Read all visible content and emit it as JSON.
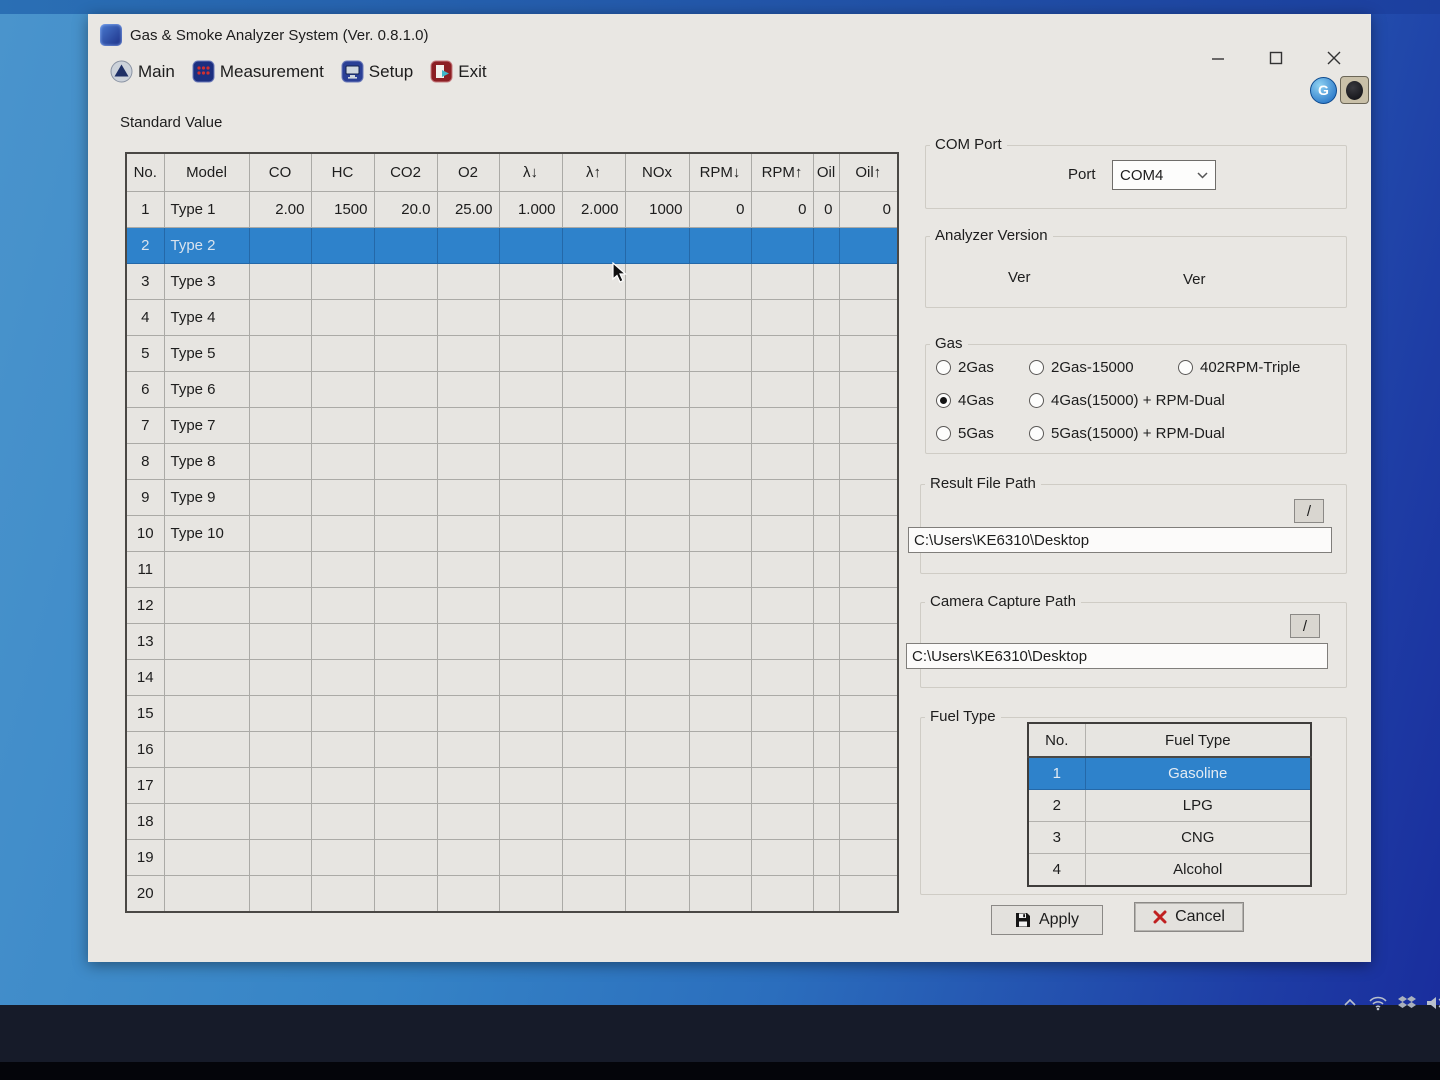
{
  "window": {
    "title": "Gas & Smoke Analyzer System (Ver. 0.8.1.0)",
    "controls": [
      "minimize-icon",
      "maximize-icon",
      "close-icon"
    ]
  },
  "menu": {
    "items": [
      {
        "id": "main",
        "label": "Main",
        "icon": "main-icon"
      },
      {
        "id": "measurement",
        "label": "Measurement",
        "icon": "measurement-icon"
      },
      {
        "id": "setup",
        "label": "Setup",
        "icon": "setup-icon"
      },
      {
        "id": "exit",
        "label": "Exit",
        "icon": "exit-icon"
      }
    ]
  },
  "corner_icons": [
    "g-badge-icon",
    "webcam-icon"
  ],
  "standard_value": {
    "section_title": "Standard Value",
    "columns": [
      "No.",
      "Model",
      "CO",
      "HC",
      "CO2",
      "O2",
      "λ↓",
      "λ↑",
      "NOx",
      "RPM↓",
      "RPM↑",
      "Oil",
      "Oil↑"
    ],
    "rows": [
      {
        "no": "1",
        "model": "Type 1",
        "selected": false,
        "values": [
          "2.00",
          "1500",
          "20.0",
          "25.00",
          "1.000",
          "2.000",
          "1000",
          "0",
          "0",
          "0",
          "0"
        ]
      },
      {
        "no": "2",
        "model": "Type 2",
        "selected": true,
        "values": []
      },
      {
        "no": "3",
        "model": "Type 3",
        "selected": false,
        "values": []
      },
      {
        "no": "4",
        "model": "Type 4",
        "selected": false,
        "values": []
      },
      {
        "no": "5",
        "model": "Type 5",
        "selected": false,
        "values": []
      },
      {
        "no": "6",
        "model": "Type 6",
        "selected": false,
        "values": []
      },
      {
        "no": "7",
        "model": "Type 7",
        "selected": false,
        "values": []
      },
      {
        "no": "8",
        "model": "Type 8",
        "selected": false,
        "values": []
      },
      {
        "no": "9",
        "model": "Type 9",
        "selected": false,
        "values": []
      },
      {
        "no": "10",
        "model": "Type 10",
        "selected": false,
        "values": []
      },
      {
        "no": "11",
        "model": "",
        "selected": false,
        "values": []
      },
      {
        "no": "12",
        "model": "",
        "selected": false,
        "values": []
      },
      {
        "no": "13",
        "model": "",
        "selected": false,
        "values": []
      },
      {
        "no": "14",
        "model": "",
        "selected": false,
        "values": []
      },
      {
        "no": "15",
        "model": "",
        "selected": false,
        "values": []
      },
      {
        "no": "16",
        "model": "",
        "selected": false,
        "values": []
      },
      {
        "no": "17",
        "model": "",
        "selected": false,
        "values": []
      },
      {
        "no": "18",
        "model": "",
        "selected": false,
        "values": []
      },
      {
        "no": "19",
        "model": "",
        "selected": false,
        "values": []
      },
      {
        "no": "20",
        "model": "",
        "selected": false,
        "values": []
      }
    ]
  },
  "com_port": {
    "group_label": "COM Port",
    "port_label": "Port",
    "port_value": "COM4",
    "dropdown_icon": "chevron-down-icon"
  },
  "analyzer_version": {
    "group_label": "Analyzer Version",
    "left_label": "Ver",
    "right_label": "Ver"
  },
  "gas": {
    "group_label": "Gas",
    "options": [
      {
        "label": "2Gas",
        "selected": false
      },
      {
        "label": "2Gas-15000",
        "selected": false
      },
      {
        "label": "402RPM-Triple",
        "selected": false
      },
      {
        "label": "4Gas",
        "selected": true
      },
      {
        "label": "4Gas(15000) + RPM-Dual",
        "selected": false
      },
      {
        "label": "5Gas",
        "selected": false
      },
      {
        "label": "5Gas(15000) + RPM-Dual",
        "selected": false
      }
    ]
  },
  "result_file_path": {
    "group_label": "Result File Path",
    "browse_label": "/",
    "value": "C:\\Users\\KE6310\\Desktop"
  },
  "camera_capture_path": {
    "group_label": "Camera Capture Path",
    "browse_label": "/",
    "value": "C:\\Users\\KE6310\\Desktop"
  },
  "fuel_type": {
    "group_label": "Fuel Type",
    "columns": [
      "No.",
      "Fuel Type"
    ],
    "rows": [
      {
        "no": "1",
        "label": "Gasoline",
        "selected": true
      },
      {
        "no": "2",
        "label": "LPG",
        "selected": false
      },
      {
        "no": "3",
        "label": "CNG",
        "selected": false
      },
      {
        "no": "4",
        "label": "Alcohol",
        "selected": false
      }
    ]
  },
  "actions": {
    "apply_label": "Apply",
    "apply_icon": "floppy-disk-icon",
    "cancel_label": "Cancel",
    "cancel_icon": "red-x-icon"
  },
  "tray_icons": [
    "chevron-up-icon",
    "wifi-icon",
    "dropbox-icon",
    "volume-icon"
  ],
  "colors": {
    "selection_blue": "#2e82cb",
    "window_bg": "#e9e7e3",
    "desktop_left": "#3583c6",
    "desktop_right": "#192c9c",
    "taskbar": "#161b29"
  }
}
